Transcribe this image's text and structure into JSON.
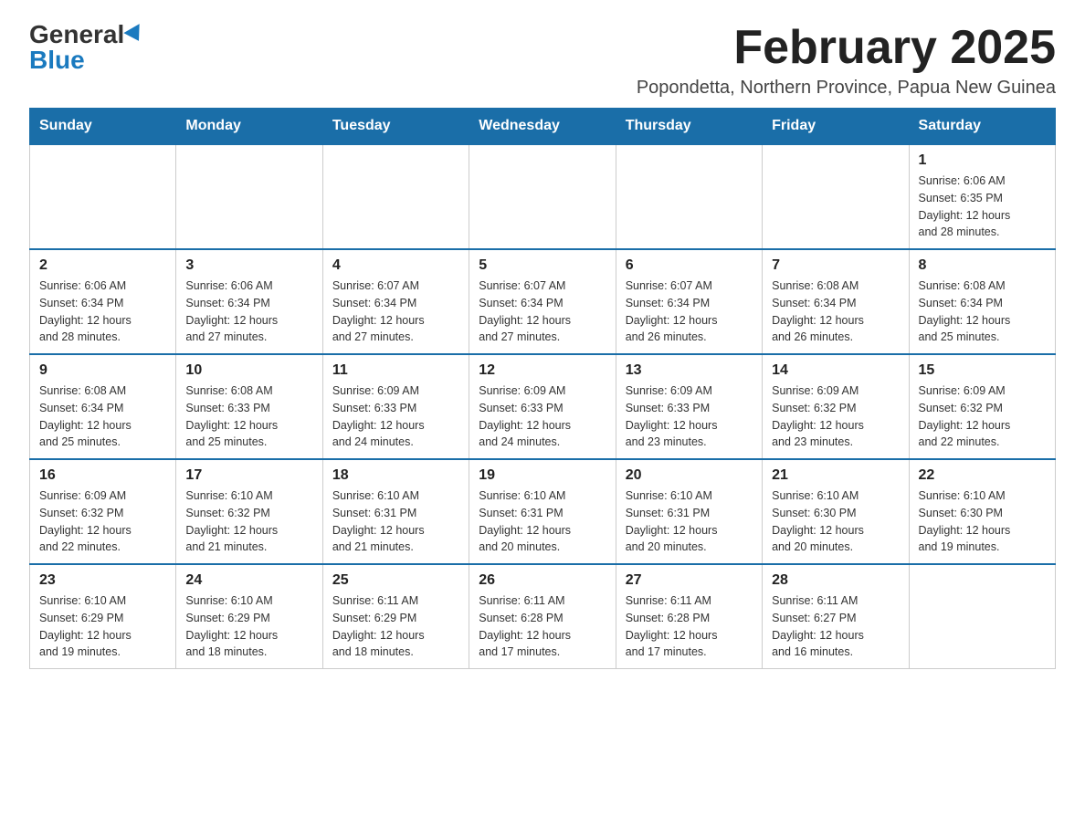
{
  "logo": {
    "general": "General",
    "blue": "Blue"
  },
  "title": "February 2025",
  "location": "Popondetta, Northern Province, Papua New Guinea",
  "days_of_week": [
    "Sunday",
    "Monday",
    "Tuesday",
    "Wednesday",
    "Thursday",
    "Friday",
    "Saturday"
  ],
  "weeks": [
    [
      {
        "day": "",
        "info": ""
      },
      {
        "day": "",
        "info": ""
      },
      {
        "day": "",
        "info": ""
      },
      {
        "day": "",
        "info": ""
      },
      {
        "day": "",
        "info": ""
      },
      {
        "day": "",
        "info": ""
      },
      {
        "day": "1",
        "info": "Sunrise: 6:06 AM\nSunset: 6:35 PM\nDaylight: 12 hours\nand 28 minutes."
      }
    ],
    [
      {
        "day": "2",
        "info": "Sunrise: 6:06 AM\nSunset: 6:34 PM\nDaylight: 12 hours\nand 28 minutes."
      },
      {
        "day": "3",
        "info": "Sunrise: 6:06 AM\nSunset: 6:34 PM\nDaylight: 12 hours\nand 27 minutes."
      },
      {
        "day": "4",
        "info": "Sunrise: 6:07 AM\nSunset: 6:34 PM\nDaylight: 12 hours\nand 27 minutes."
      },
      {
        "day": "5",
        "info": "Sunrise: 6:07 AM\nSunset: 6:34 PM\nDaylight: 12 hours\nand 27 minutes."
      },
      {
        "day": "6",
        "info": "Sunrise: 6:07 AM\nSunset: 6:34 PM\nDaylight: 12 hours\nand 26 minutes."
      },
      {
        "day": "7",
        "info": "Sunrise: 6:08 AM\nSunset: 6:34 PM\nDaylight: 12 hours\nand 26 minutes."
      },
      {
        "day": "8",
        "info": "Sunrise: 6:08 AM\nSunset: 6:34 PM\nDaylight: 12 hours\nand 25 minutes."
      }
    ],
    [
      {
        "day": "9",
        "info": "Sunrise: 6:08 AM\nSunset: 6:34 PM\nDaylight: 12 hours\nand 25 minutes."
      },
      {
        "day": "10",
        "info": "Sunrise: 6:08 AM\nSunset: 6:33 PM\nDaylight: 12 hours\nand 25 minutes."
      },
      {
        "day": "11",
        "info": "Sunrise: 6:09 AM\nSunset: 6:33 PM\nDaylight: 12 hours\nand 24 minutes."
      },
      {
        "day": "12",
        "info": "Sunrise: 6:09 AM\nSunset: 6:33 PM\nDaylight: 12 hours\nand 24 minutes."
      },
      {
        "day": "13",
        "info": "Sunrise: 6:09 AM\nSunset: 6:33 PM\nDaylight: 12 hours\nand 23 minutes."
      },
      {
        "day": "14",
        "info": "Sunrise: 6:09 AM\nSunset: 6:32 PM\nDaylight: 12 hours\nand 23 minutes."
      },
      {
        "day": "15",
        "info": "Sunrise: 6:09 AM\nSunset: 6:32 PM\nDaylight: 12 hours\nand 22 minutes."
      }
    ],
    [
      {
        "day": "16",
        "info": "Sunrise: 6:09 AM\nSunset: 6:32 PM\nDaylight: 12 hours\nand 22 minutes."
      },
      {
        "day": "17",
        "info": "Sunrise: 6:10 AM\nSunset: 6:32 PM\nDaylight: 12 hours\nand 21 minutes."
      },
      {
        "day": "18",
        "info": "Sunrise: 6:10 AM\nSunset: 6:31 PM\nDaylight: 12 hours\nand 21 minutes."
      },
      {
        "day": "19",
        "info": "Sunrise: 6:10 AM\nSunset: 6:31 PM\nDaylight: 12 hours\nand 20 minutes."
      },
      {
        "day": "20",
        "info": "Sunrise: 6:10 AM\nSunset: 6:31 PM\nDaylight: 12 hours\nand 20 minutes."
      },
      {
        "day": "21",
        "info": "Sunrise: 6:10 AM\nSunset: 6:30 PM\nDaylight: 12 hours\nand 20 minutes."
      },
      {
        "day": "22",
        "info": "Sunrise: 6:10 AM\nSunset: 6:30 PM\nDaylight: 12 hours\nand 19 minutes."
      }
    ],
    [
      {
        "day": "23",
        "info": "Sunrise: 6:10 AM\nSunset: 6:29 PM\nDaylight: 12 hours\nand 19 minutes."
      },
      {
        "day": "24",
        "info": "Sunrise: 6:10 AM\nSunset: 6:29 PM\nDaylight: 12 hours\nand 18 minutes."
      },
      {
        "day": "25",
        "info": "Sunrise: 6:11 AM\nSunset: 6:29 PM\nDaylight: 12 hours\nand 18 minutes."
      },
      {
        "day": "26",
        "info": "Sunrise: 6:11 AM\nSunset: 6:28 PM\nDaylight: 12 hours\nand 17 minutes."
      },
      {
        "day": "27",
        "info": "Sunrise: 6:11 AM\nSunset: 6:28 PM\nDaylight: 12 hours\nand 17 minutes."
      },
      {
        "day": "28",
        "info": "Sunrise: 6:11 AM\nSunset: 6:27 PM\nDaylight: 12 hours\nand 16 minutes."
      },
      {
        "day": "",
        "info": ""
      }
    ]
  ]
}
